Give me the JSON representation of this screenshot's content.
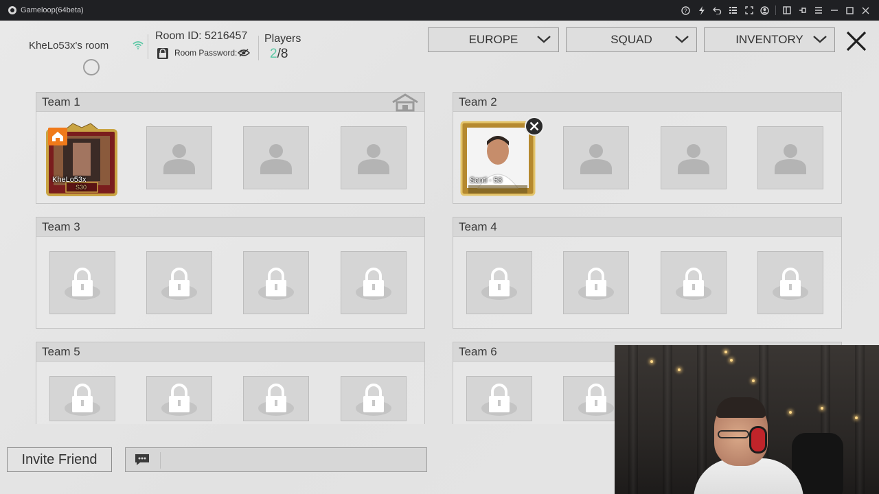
{
  "titlebar": {
    "title": "Gameloop(64beta)",
    "icons": [
      "help-icon",
      "boost-icon",
      "back-icon",
      "keyboard-icon",
      "fullscreen-icon",
      "settings-icon",
      "sidebar-icon",
      "pin-icon",
      "menu-icon",
      "minimize-icon",
      "maximize-icon",
      "close-icon"
    ]
  },
  "room": {
    "owner_label": "KheLo53x's room",
    "room_id": "Room ID: 5216457",
    "password_label": "Room Password: *",
    "players_label": "Players",
    "players_current": "2",
    "players_total": "/8"
  },
  "filters": {
    "region": "EUROPE",
    "mode": "SQUAD",
    "inventory": "INVENTORY"
  },
  "teams": [
    {
      "name": "Team 1"
    },
    {
      "name": "Team 2"
    },
    {
      "name": "Team 3"
    },
    {
      "name": "Team 4"
    },
    {
      "name": "Team 5"
    },
    {
      "name": "Team 6"
    }
  ],
  "players": {
    "host": {
      "name": "KheLo53x",
      "badge": "S30"
    },
    "guest": {
      "name": "Santi",
      "level": "53",
      "separator": "·"
    }
  },
  "bottom": {
    "invite_label": "Invite Friend"
  },
  "colors": {
    "accent_green": "#58c7a3",
    "host_badge": "#f07a1a",
    "frame_gold": "#c9a443"
  }
}
